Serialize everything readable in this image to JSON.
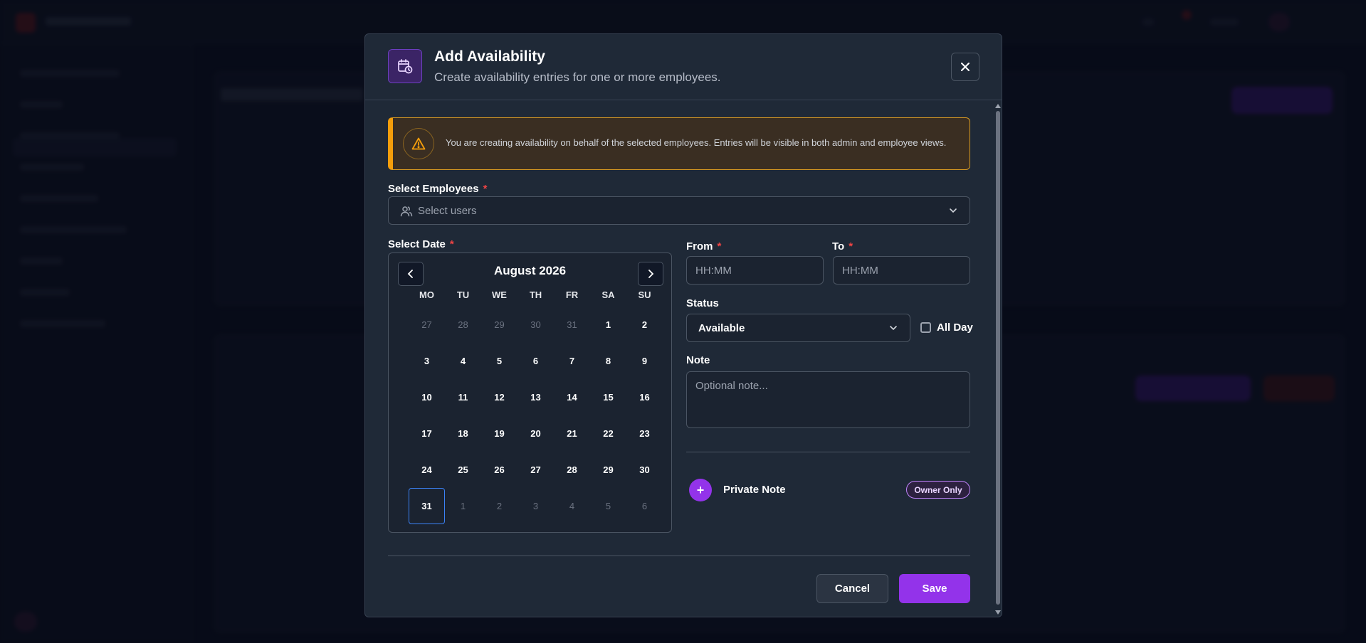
{
  "modal": {
    "title": "Add Availability",
    "subtitle": "Create availability entries for one or more employees.",
    "warning": "You are creating availability on behalf of the selected employees. Entries will be visible in both admin and employee views.",
    "employees_label": "Select Employees",
    "employees_placeholder": "Select users",
    "date_label": "Select Date",
    "required_marker": "*",
    "from_label": "From",
    "to_label": "To",
    "time_placeholder": "HH:MM",
    "status_label": "Status",
    "status_value": "Available",
    "allday_label": "All Day",
    "allday_checked": false,
    "note_label": "Note",
    "note_placeholder": "Optional note...",
    "private_note_label": "Private Note",
    "private_note_add": "+",
    "owner_badge": "Owner Only",
    "cancel_label": "Cancel",
    "save_label": "Save"
  },
  "calendar": {
    "month": "August 2026",
    "weekdays": [
      "MO",
      "TU",
      "WE",
      "TH",
      "FR",
      "SA",
      "SU"
    ],
    "weeks": [
      [
        {
          "d": "27",
          "m": true
        },
        {
          "d": "28",
          "m": true
        },
        {
          "d": "29",
          "m": true
        },
        {
          "d": "30",
          "m": true
        },
        {
          "d": "31",
          "m": true
        },
        {
          "d": "1"
        },
        {
          "d": "2"
        }
      ],
      [
        {
          "d": "3"
        },
        {
          "d": "4"
        },
        {
          "d": "5"
        },
        {
          "d": "6"
        },
        {
          "d": "7"
        },
        {
          "d": "8"
        },
        {
          "d": "9"
        }
      ],
      [
        {
          "d": "10"
        },
        {
          "d": "11"
        },
        {
          "d": "12"
        },
        {
          "d": "13"
        },
        {
          "d": "14"
        },
        {
          "d": "15"
        },
        {
          "d": "16"
        }
      ],
      [
        {
          "d": "17"
        },
        {
          "d": "18"
        },
        {
          "d": "19"
        },
        {
          "d": "20"
        },
        {
          "d": "21"
        },
        {
          "d": "22"
        },
        {
          "d": "23"
        }
      ],
      [
        {
          "d": "24"
        },
        {
          "d": "25"
        },
        {
          "d": "26"
        },
        {
          "d": "27"
        },
        {
          "d": "28"
        },
        {
          "d": "29"
        },
        {
          "d": "30"
        }
      ],
      [
        {
          "d": "31",
          "s": true
        },
        {
          "d": "1",
          "m": true
        },
        {
          "d": "2",
          "m": true
        },
        {
          "d": "3",
          "m": true
        },
        {
          "d": "4",
          "m": true
        },
        {
          "d": "5",
          "m": true
        },
        {
          "d": "6",
          "m": true
        }
      ]
    ]
  },
  "colors": {
    "accent": "#9333ea",
    "warning": "#f59e0b",
    "required": "#ef4444",
    "selected_day": "#3b82f6"
  },
  "icons": {
    "header": "calendar-clock-icon",
    "close": "close-icon",
    "warning": "warning-triangle-icon",
    "users": "users-icon",
    "dropdown": "chevron-down-icon",
    "prev": "chevron-left-icon",
    "next": "chevron-right-icon"
  }
}
